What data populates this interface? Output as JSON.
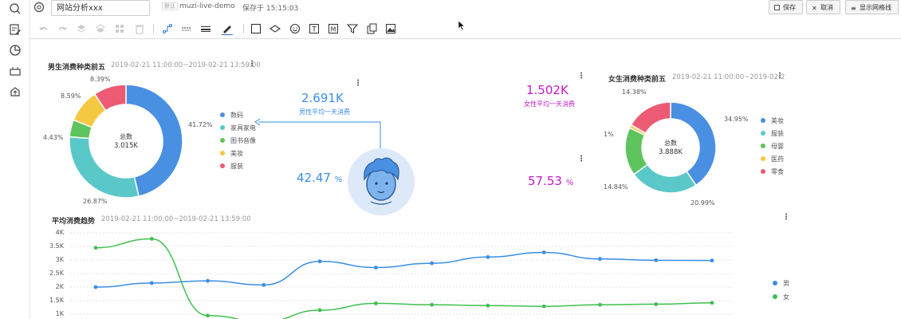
{
  "topbar": {
    "report_name": "网站分析xxx",
    "crumb_tag": "默认",
    "crumb": "muzi-live-demo",
    "saved": "保存于 15:15:03",
    "save_label": "保存",
    "cancel_label": "取消",
    "grid_label": "显示网格线"
  },
  "sidebar": [
    "search-icon",
    "edit-icon",
    "pie-chart-icon",
    "dashboard-icon",
    "upload-icon"
  ],
  "toolbar": [
    "undo-icon",
    "redo-icon",
    "layer-up-icon",
    "layer-down-icon",
    "grid-icon",
    "trash-icon",
    "connector-icon",
    "dashed-line-icon",
    "line-weight-icon",
    "pen-icon",
    "rectangle-icon",
    "diamond-icon",
    "smiley-icon",
    "text-box-icon",
    "markdown-icon",
    "filter-icon",
    "export-icon",
    "image-icon"
  ],
  "male_panel": {
    "title": "男生消费种类前五",
    "time": "2019-02-21 11:00:00~2019-02-21 13:59:00",
    "center_label": "总数",
    "center_value": "3.015K",
    "chart_data": {
      "type": "pie",
      "categories": [
        "数码",
        "家具家电",
        "图书音像",
        "美妆",
        "服装"
      ],
      "values": [
        41.72,
        26.87,
        4.43,
        8.59,
        8.39
      ],
      "labels": [
        "41.72%",
        "26.87%",
        "4.43%",
        "8.59%",
        "8.39%"
      ],
      "colors": [
        "#4a90e2",
        "#5ac8c8",
        "#5ec45e",
        "#f5c842",
        "#ec5b73"
      ]
    }
  },
  "female_panel": {
    "title": "女生消费种类前五",
    "time": "2019-02-21 11:00:00~2019-02-2",
    "center_label": "总数",
    "center_value": "3.888K",
    "chart_data": {
      "type": "pie",
      "categories": [
        "美妆",
        "服装",
        "母婴",
        "医药",
        "零食"
      ],
      "values": [
        34.95,
        20.99,
        14.84,
        1,
        14.38
      ],
      "labels": [
        "34.95%",
        "20.99%",
        "14.84%",
        "1%",
        "14.38%"
      ],
      "colors": [
        "#4a90e2",
        "#5ac8c8",
        "#5ec45e",
        "#f5c842",
        "#ec5b73"
      ]
    }
  },
  "kpi": {
    "male_value": "2.691K",
    "male_caption": "男性平均一天消费",
    "female_value": "1.502K",
    "female_caption": "女性平均一天消费",
    "male_pct": "42.47",
    "female_pct": "57.53",
    "pct_unit": "%"
  },
  "trend_panel": {
    "title": "平均消费趋势",
    "time": "2019-02-21 11:00:00~2019-02-21 13:59:00",
    "chart_data": {
      "type": "line",
      "yticks": [
        "4K",
        "3.5K",
        "3K",
        "2.5K",
        "2K",
        "1.5K",
        "1K"
      ],
      "ylim": [
        1000,
        4000
      ],
      "series": [
        {
          "name": "男",
          "color": "#3a8ee6",
          "values": [
            2000,
            2150,
            2230,
            2080,
            2950,
            2720,
            2880,
            3110,
            3280,
            3040,
            2990,
            2980
          ]
        },
        {
          "name": "女",
          "color": "#3fbf4f",
          "values": [
            3450,
            3780,
            950,
            720,
            1150,
            1400,
            1350,
            1320,
            1290,
            1350,
            1370,
            1420
          ]
        }
      ]
    }
  }
}
